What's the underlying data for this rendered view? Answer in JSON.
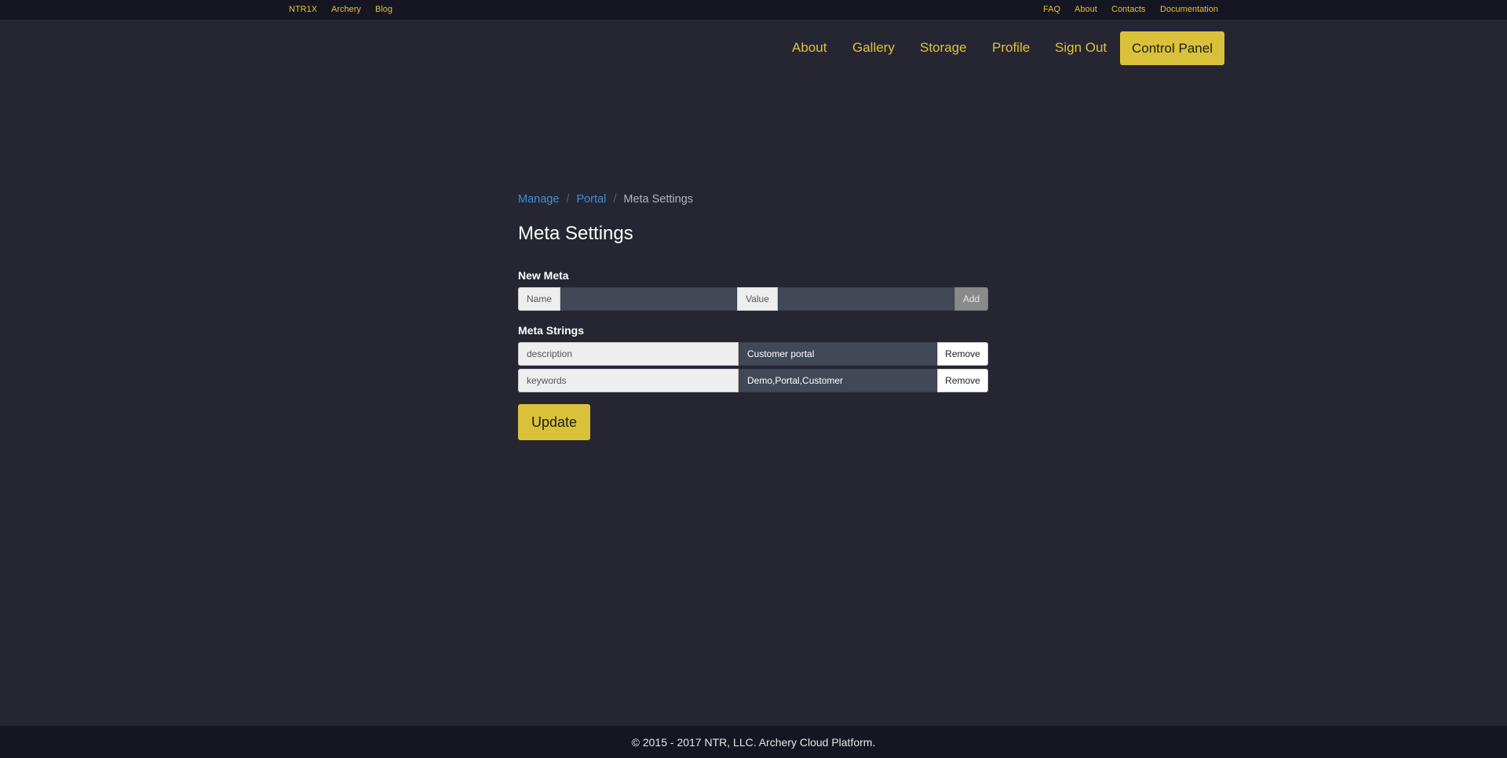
{
  "topbar": {
    "left_links": [
      "NTR1X",
      "Archery",
      "Blog"
    ],
    "right_links": [
      "FAQ",
      "About",
      "Contacts",
      "Documentation"
    ]
  },
  "nav": {
    "links": [
      "About",
      "Gallery",
      "Storage",
      "Profile",
      "Sign Out"
    ],
    "control_panel": "Control Panel"
  },
  "breadcrumb": {
    "items": [
      "Manage",
      "Portal"
    ],
    "active": "Meta Settings",
    "separator": "/"
  },
  "page": {
    "title": "Meta Settings"
  },
  "new_meta": {
    "heading": "New Meta",
    "name_label": "Name",
    "name_value": "",
    "value_label": "Value",
    "value_value": "",
    "add_label": "Add"
  },
  "meta_strings": {
    "heading": "Meta Strings",
    "rows": [
      {
        "name": "description",
        "value": "Customer portal",
        "remove_label": "Remove"
      },
      {
        "name": "keywords",
        "value": "Demo,Portal,Customer",
        "remove_label": "Remove"
      }
    ]
  },
  "update_label": "Update",
  "footer": {
    "text": "© 2015 - 2017 NTR, LLC. Archery Cloud Platform."
  },
  "colors": {
    "accent": "#d9c23a",
    "link": "#3c8fd6",
    "background": "#262633",
    "bar": "#161622"
  }
}
